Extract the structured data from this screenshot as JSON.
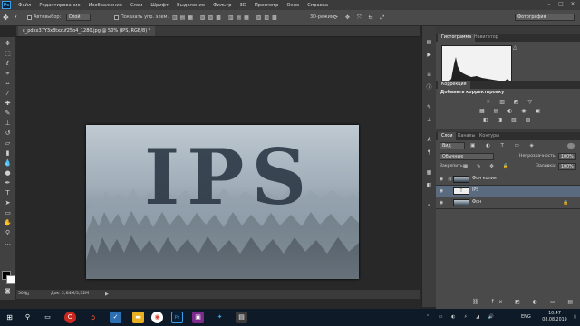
{
  "app": {
    "logo": "Ps"
  },
  "menu": [
    "Файл",
    "Редактирование",
    "Изображение",
    "Слои",
    "Шрифт",
    "Выделение",
    "Фильтр",
    "3D",
    "Просмотр",
    "Окно",
    "Справка"
  ],
  "options": {
    "autoselect_label": "Автовыбор:",
    "autoselect_value": "Слой",
    "show_controls_label": "Показать упр. элем.",
    "mode_3d_label": "3D-режим:",
    "workspace": "Фотография"
  },
  "document": {
    "tab_title": "c_pdxx37Y3x8txzuf25o4_1280.jpg @ 50% (IPS, RGB/8) *",
    "text": "IPS"
  },
  "status": {
    "zoom": "50%",
    "doc_info": "Док: 2,64M/5,32M"
  },
  "panels": {
    "histogram_tabs": [
      "Гистограмма",
      "Навигатор"
    ],
    "corrections_tab": "Коррекция",
    "corrections_subtitle": "Добавить корректировку",
    "layers_tabs": [
      "Слои",
      "Каналы",
      "Контуры"
    ],
    "filter_kind": "Вид",
    "blend_mode": "Обычные",
    "opacity_label": "Непрозрачность:",
    "opacity_value": "100%",
    "lock_label": "Закрепить:",
    "fill_label": "Заливка:",
    "fill_value": "100%",
    "layers": [
      {
        "name": "Фон копия"
      },
      {
        "name": "IPS"
      },
      {
        "name": "Фон"
      }
    ]
  },
  "taskbar": {
    "lang": "ENG",
    "time": "10:47",
    "date": "08.08.2019"
  },
  "colors": {
    "accent": "#3aa0e8",
    "selected_layer": "#5a6b80",
    "taskbar": "#0e1a28"
  }
}
